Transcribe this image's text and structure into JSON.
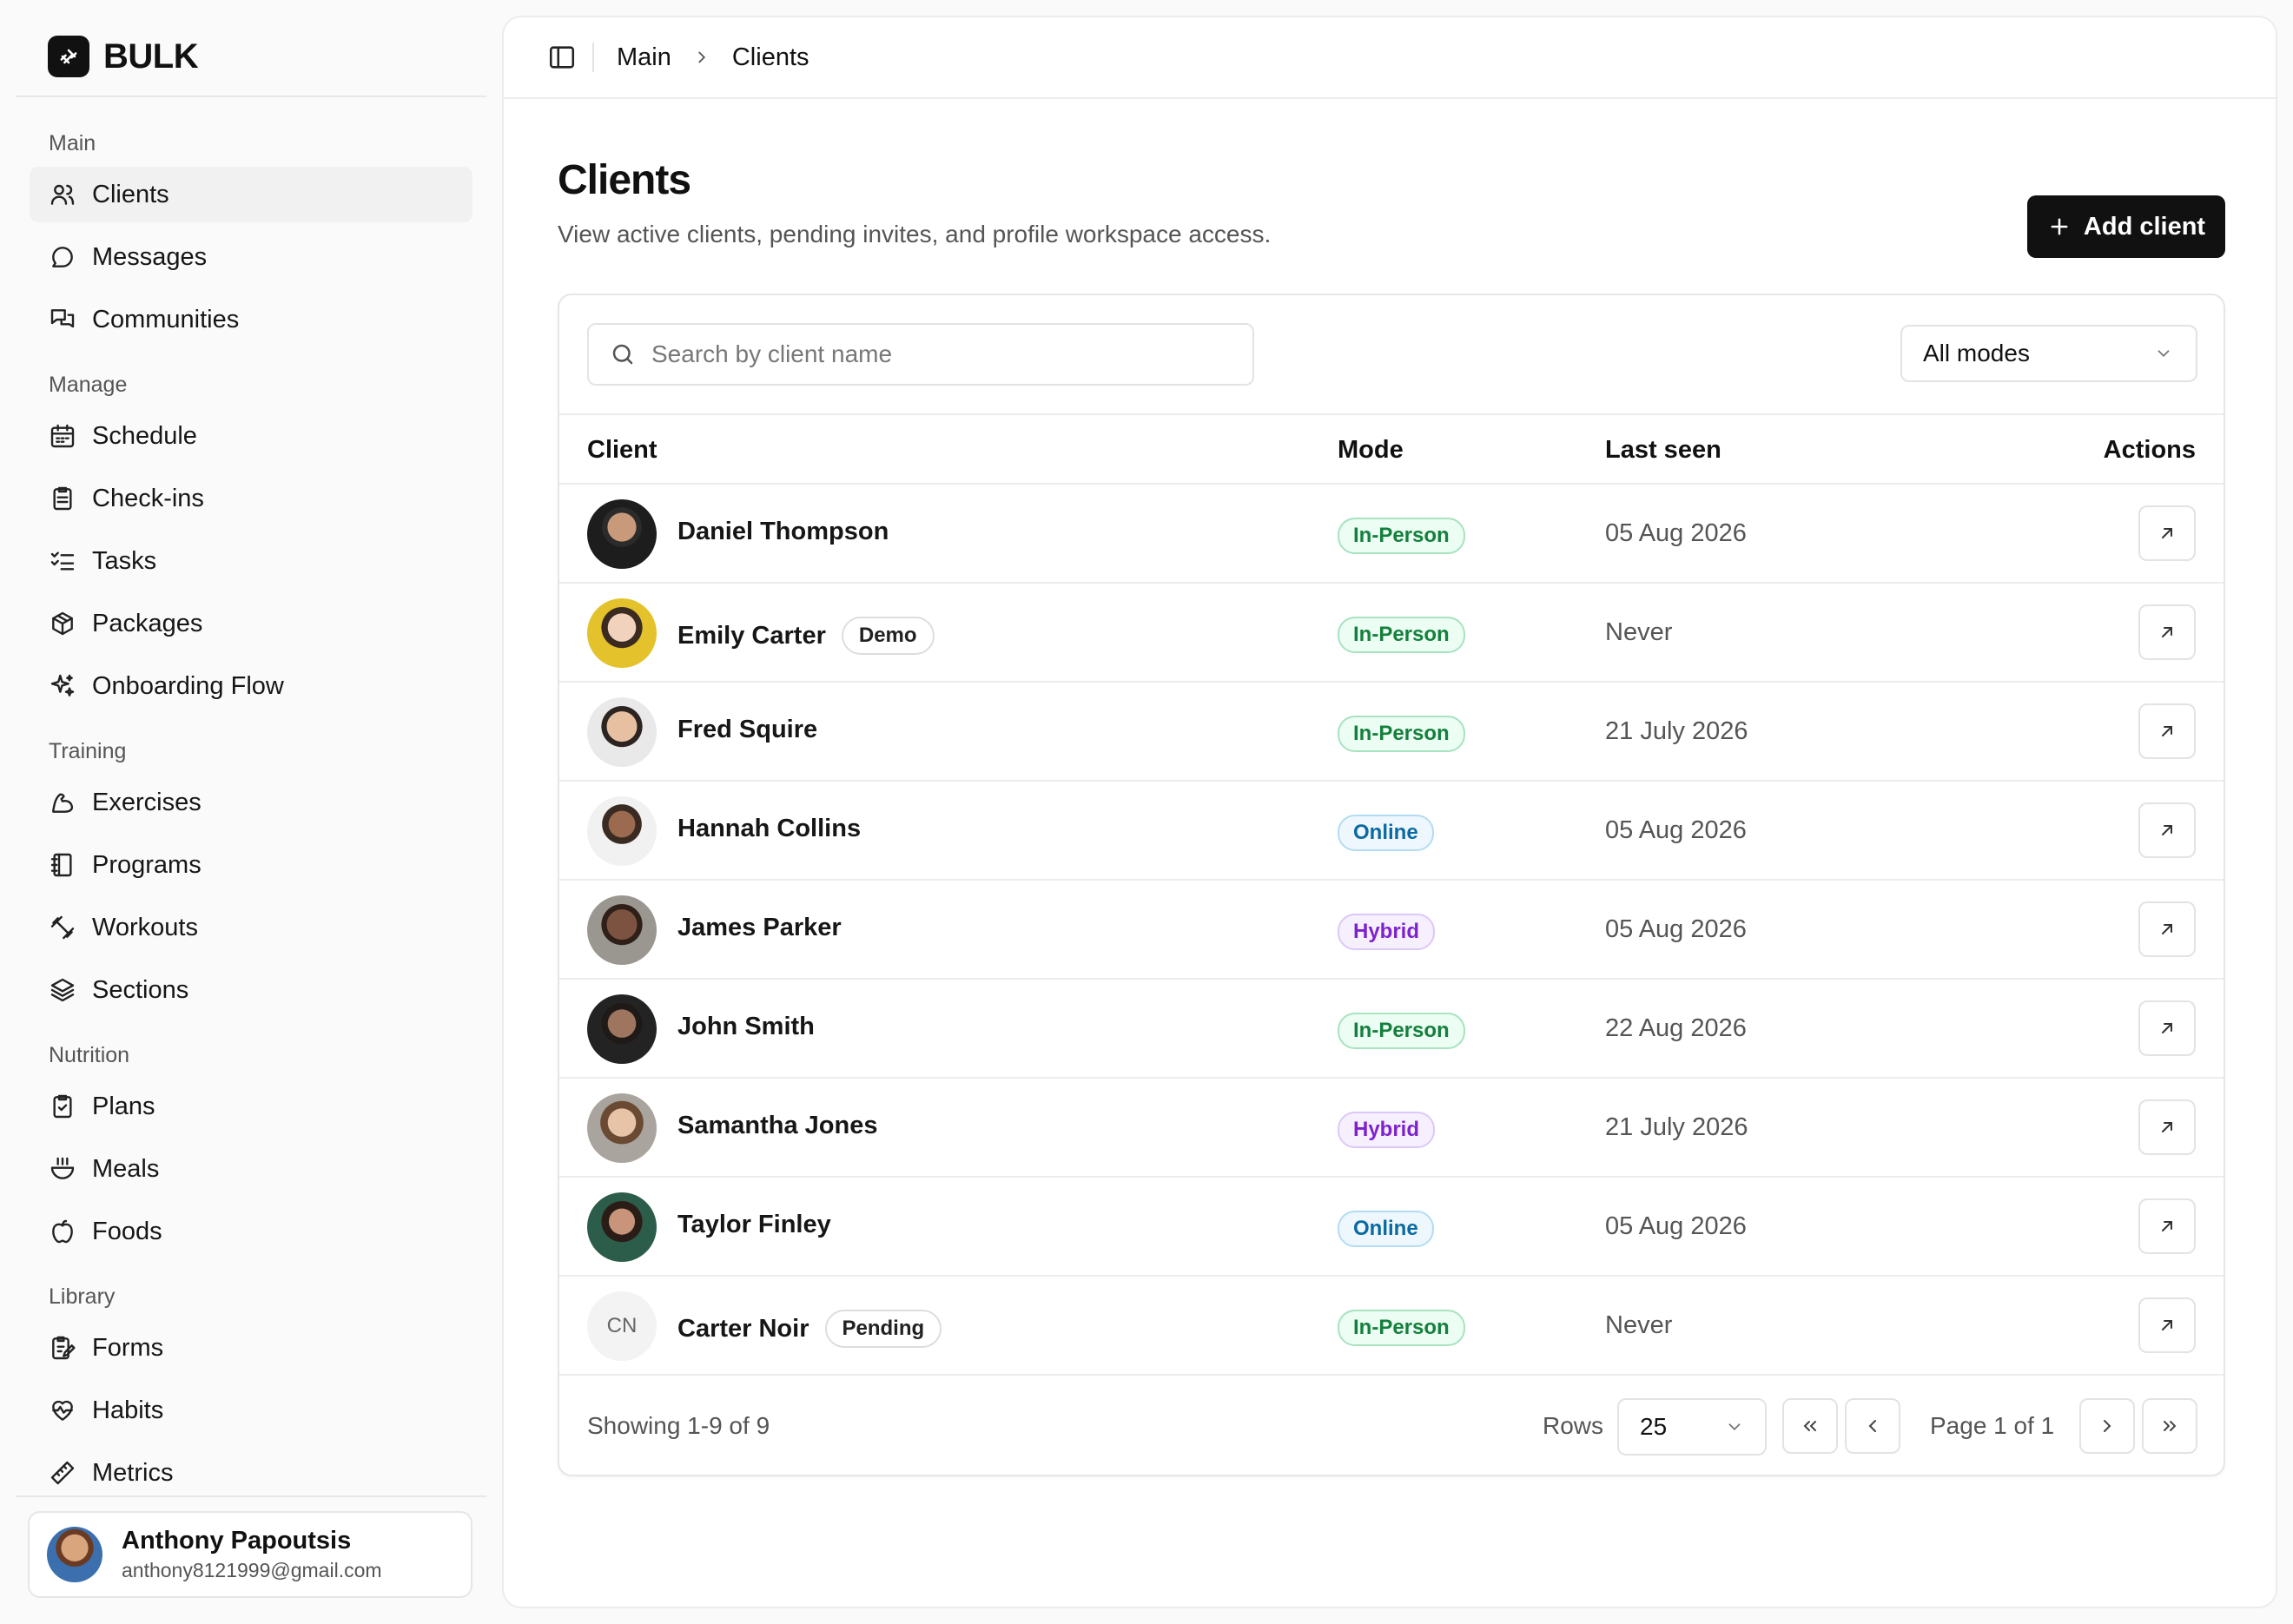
{
  "brand": {
    "name": "BULK"
  },
  "nav": {
    "groups": [
      {
        "label": "Main",
        "items": [
          {
            "label": "Clients",
            "icon": "users-icon",
            "active": true
          },
          {
            "label": "Messages",
            "icon": "message-icon"
          },
          {
            "label": "Communities",
            "icon": "chats-icon"
          }
        ]
      },
      {
        "label": "Manage",
        "items": [
          {
            "label": "Schedule",
            "icon": "calendar-icon"
          },
          {
            "label": "Check-ins",
            "icon": "clipboard-icon"
          },
          {
            "label": "Tasks",
            "icon": "checklist-icon"
          },
          {
            "label": "Packages",
            "icon": "package-icon"
          },
          {
            "label": "Onboarding Flow",
            "icon": "sparkles-icon"
          }
        ]
      },
      {
        "label": "Training",
        "items": [
          {
            "label": "Exercises",
            "icon": "bicep-icon"
          },
          {
            "label": "Programs",
            "icon": "book-icon"
          },
          {
            "label": "Workouts",
            "icon": "dumbbell-icon"
          },
          {
            "label": "Sections",
            "icon": "layers-icon"
          }
        ]
      },
      {
        "label": "Nutrition",
        "items": [
          {
            "label": "Plans",
            "icon": "clipboard-check-icon"
          },
          {
            "label": "Meals",
            "icon": "bowl-icon"
          },
          {
            "label": "Foods",
            "icon": "apple-icon"
          }
        ]
      },
      {
        "label": "Library",
        "items": [
          {
            "label": "Forms",
            "icon": "form-icon"
          },
          {
            "label": "Habits",
            "icon": "heart-pulse-icon"
          },
          {
            "label": "Metrics",
            "icon": "ruler-icon"
          }
        ]
      }
    ]
  },
  "user": {
    "name": "Anthony Papoutsis",
    "email": "anthony8121999@gmail.com"
  },
  "breadcrumb": {
    "root": "Main",
    "current": "Clients"
  },
  "page": {
    "title": "Clients",
    "subtitle": "View active clients, pending invites, and profile workspace access.",
    "add_label": "Add client"
  },
  "search": {
    "placeholder": "Search by client name"
  },
  "filter": {
    "selected": "All modes"
  },
  "table": {
    "headers": {
      "client": "Client",
      "mode": "Mode",
      "last_seen": "Last seen",
      "actions": "Actions"
    },
    "rows": [
      {
        "name": "Daniel Thompson",
        "tag": "",
        "mode": "In-Person",
        "last_seen": "05 Aug 2026",
        "initials": ""
      },
      {
        "name": "Emily Carter",
        "tag": "Demo",
        "mode": "In-Person",
        "last_seen": "Never",
        "initials": ""
      },
      {
        "name": "Fred Squire",
        "tag": "",
        "mode": "In-Person",
        "last_seen": "21 July 2026",
        "initials": ""
      },
      {
        "name": "Hannah Collins",
        "tag": "",
        "mode": "Online",
        "last_seen": "05 Aug 2026",
        "initials": ""
      },
      {
        "name": "James Parker",
        "tag": "",
        "mode": "Hybrid",
        "last_seen": "05 Aug 2026",
        "initials": ""
      },
      {
        "name": "John Smith",
        "tag": "",
        "mode": "In-Person",
        "last_seen": "22 Aug 2026",
        "initials": ""
      },
      {
        "name": "Samantha Jones",
        "tag": "",
        "mode": "Hybrid",
        "last_seen": "21 July 2026",
        "initials": ""
      },
      {
        "name": "Taylor Finley",
        "tag": "",
        "mode": "Online",
        "last_seen": "05 Aug 2026",
        "initials": ""
      },
      {
        "name": "Carter Noir",
        "tag": "Pending",
        "mode": "In-Person",
        "last_seen": "Never",
        "initials": "CN"
      }
    ]
  },
  "mode_colors": {
    "In-Person": {
      "text": "#15803d",
      "bg": "#ecfdf3",
      "border": "#a7e3bf"
    },
    "Online": {
      "text": "#0b6aa2",
      "bg": "#eef7fd",
      "border": "#b3dcf2"
    },
    "Hybrid": {
      "text": "#7e22ce",
      "bg": "#f6f0fe",
      "border": "#dcc8f7"
    }
  },
  "footer": {
    "showing": "Showing 1-9 of 9",
    "rows_label": "Rows",
    "rows_value": "25",
    "page_info": "Page 1 of 1"
  }
}
